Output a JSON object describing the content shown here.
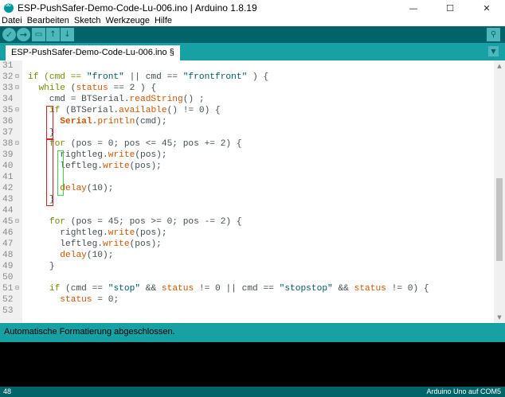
{
  "window": {
    "title": "ESP-PushSafer-Demo-Code-Lu-006.ino | Arduino 1.8.19",
    "minimize": "—",
    "maximize": "☐",
    "close": "✕"
  },
  "menu": [
    "Datei",
    "Bearbeiten",
    "Sketch",
    "Werkzeuge",
    "Hilfe"
  ],
  "toolbar": {
    "verify_icon": "check-icon",
    "upload_icon": "arrow-right-icon",
    "new_icon": "file-icon",
    "open_icon": "arrow-up-icon",
    "save_icon": "arrow-down-icon",
    "serial_monitor_icon": "magnifier-icon"
  },
  "tab": {
    "label": "ESP-PushSafer-Demo-Code-Lu-006.ino §"
  },
  "code_lines": [
    {
      "num": "31",
      "fold": false
    },
    {
      "num": "32",
      "fold": true
    },
    {
      "num": "33",
      "fold": true
    },
    {
      "num": "34",
      "fold": false
    },
    {
      "num": "35",
      "fold": true
    },
    {
      "num": "36",
      "fold": false
    },
    {
      "num": "37",
      "fold": false
    },
    {
      "num": "38",
      "fold": true
    },
    {
      "num": "39",
      "fold": false
    },
    {
      "num": "40",
      "fold": false
    },
    {
      "num": "41",
      "fold": false
    },
    {
      "num": "42",
      "fold": false
    },
    {
      "num": "43",
      "fold": false
    },
    {
      "num": "44",
      "fold": false
    },
    {
      "num": "45",
      "fold": true
    },
    {
      "num": "46",
      "fold": false
    },
    {
      "num": "47",
      "fold": false
    },
    {
      "num": "48",
      "fold": false
    },
    {
      "num": "49",
      "fold": false
    },
    {
      "num": "50",
      "fold": false
    },
    {
      "num": "51",
      "fold": true
    },
    {
      "num": "52",
      "fold": false
    },
    {
      "num": "53",
      "fold": false
    }
  ],
  "code": {
    "l32": {
      "a": "if (cmd == ",
      "s1": "\"front\"",
      "b": " || cmd == ",
      "s2": "\"frontfront\"",
      "c": " ) {"
    },
    "l33": {
      "a": "while",
      "b": " (",
      "c": "status",
      "d": " == 2 ) {"
    },
    "l34": {
      "a": "cmd = BTSerial.",
      "b": "readString",
      "c": "() ;"
    },
    "l35": {
      "a": "if",
      "b": " (BTSerial.",
      "c": "available",
      "d": "() != 0) {"
    },
    "l36": {
      "a": "Serial",
      "b": ".",
      "c": "println",
      "d": "(cmd);"
    },
    "l37": {
      "a": "}"
    },
    "l38": {
      "a": "for",
      "b": " (pos = 0; pos <= 45; pos += 2) {"
    },
    "l39": {
      "a": "rightleg.",
      "b": "write",
      "c": "(pos);"
    },
    "l40": {
      "a": "leftleg.",
      "b": "write",
      "c": "(pos);"
    },
    "l42": {
      "a": "delay",
      "b": "(10);"
    },
    "l43": {
      "a": "}"
    },
    "l45": {
      "a": "for",
      "b": " (pos = 45; pos >= 0; pos -= 2) {"
    },
    "l46": {
      "a": "rightleg.",
      "b": "write",
      "c": "(pos);"
    },
    "l47": {
      "a": "leftleg.",
      "b": "write",
      "c": "(pos);"
    },
    "l48": {
      "a": "delay",
      "b": "(10);"
    },
    "l49": {
      "a": "}"
    },
    "l51": {
      "a": "if",
      "b": " (cmd == ",
      "s1": "\"stop\"",
      "c": " && ",
      "d": "status",
      "e": " != 0 || cmd == ",
      "s2": "\"stopstop\"",
      "f": " && ",
      "g": "status",
      "h": " != 0) {"
    },
    "l52": {
      "a": "status",
      "b": " = 0;"
    }
  },
  "status": {
    "message": "Automatische Formatierung abgeschlossen."
  },
  "footer": {
    "line": "48",
    "board": "Arduino Uno auf COM5"
  },
  "colors": {
    "toolbar": "#006468",
    "tabbar": "#17a1a5",
    "keyword": "#728e00",
    "function": "#d35400",
    "string": "#005c5f"
  }
}
